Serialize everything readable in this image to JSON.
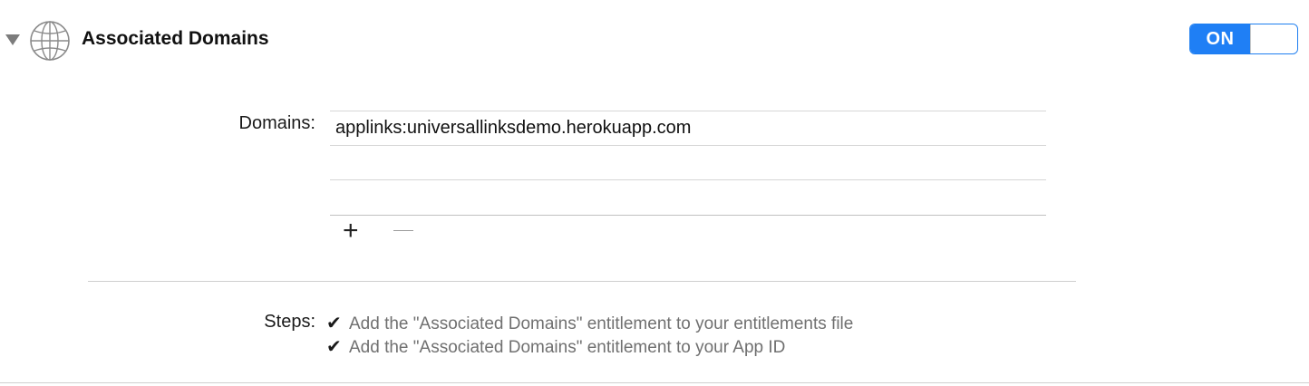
{
  "header": {
    "title": "Associated Domains",
    "icon": "globe-icon",
    "disclosure_icon": "disclosure-triangle-icon",
    "toggle_label": "ON",
    "accent_color": "#1f7ff5"
  },
  "domains": {
    "label": "Domains:",
    "rows": [
      "applinks:universallinksdemo.herokuapp.com",
      "",
      ""
    ],
    "add_symbol": "+",
    "remove_symbol": "−"
  },
  "steps": {
    "label": "Steps:",
    "check_icon": "checkmark-icon",
    "items": [
      "Add the \"Associated Domains\" entitlement to your entitlements file",
      "Add the \"Associated Domains\" entitlement to your App ID"
    ]
  }
}
